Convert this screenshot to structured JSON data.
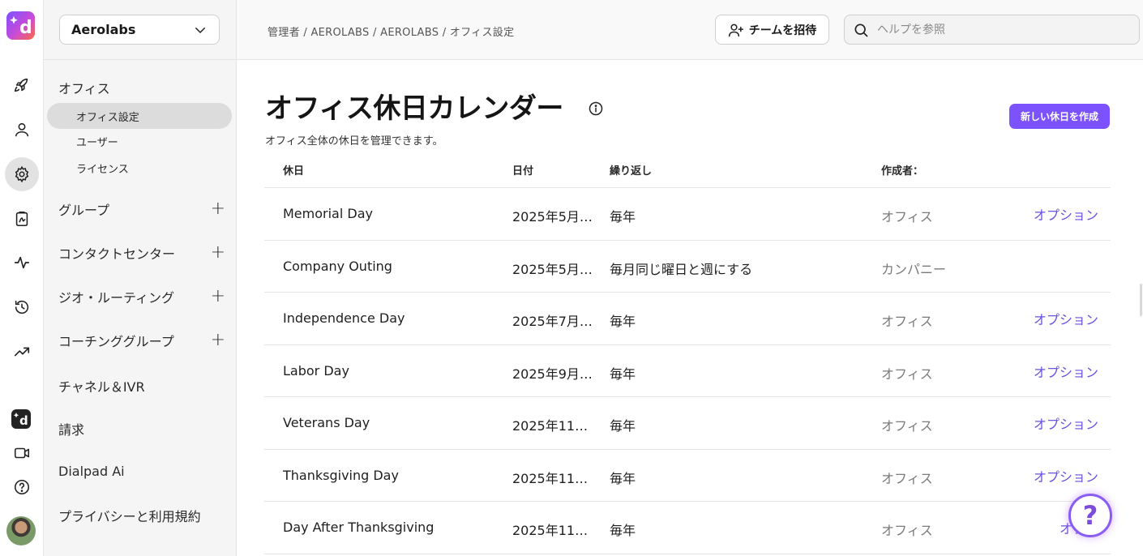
{
  "rail": {
    "items": [
      {
        "icon": "rocket-icon"
      },
      {
        "icon": "user-icon"
      },
      {
        "icon": "gear-icon",
        "active": true
      },
      {
        "icon": "clipboard-icon"
      },
      {
        "icon": "activity-icon"
      },
      {
        "icon": "history-icon"
      },
      {
        "icon": "trending-icon"
      }
    ],
    "bottom": [
      {
        "icon": "dialpad-app-icon"
      },
      {
        "icon": "video-icon"
      },
      {
        "icon": "help-circle-icon"
      },
      {
        "icon": "avatar"
      }
    ]
  },
  "nav": {
    "org": "Aerolabs",
    "section_office": "オフィス",
    "office_items": [
      "オフィス設定",
      "ユーザー",
      "ライセンス"
    ],
    "groups": [
      "グループ",
      "コンタクトセンター",
      "ジオ・ルーティング",
      "コーチンググループ"
    ],
    "links": [
      "チャネル＆IVR",
      "請求",
      "Dialpad Ai",
      "プライバシーと利用規約"
    ]
  },
  "header": {
    "breadcrumb": "管理者 / AEROLABS / AEROLABS / オフィス設定",
    "invite_label": "チームを招待",
    "search_placeholder": "ヘルプを参照"
  },
  "main": {
    "title": "オフィス休日カレンダー",
    "subtitle": "オフィス全体の休日を管理できます。",
    "create_label": "新しい休日を作成",
    "columns": [
      "休日",
      "日付",
      "繰り返し",
      "作成者："
    ],
    "rows": [
      {
        "name": "Memorial Day",
        "date": "2025年5月…",
        "repeat": "毎年",
        "by": "オフィス",
        "option": "オプション"
      },
      {
        "name": "Company Outing",
        "date": "2025年5月…",
        "repeat": "毎月同じ曜日と週にする",
        "by": "カンパニー",
        "option": ""
      },
      {
        "name": "Independence Day",
        "date": "2025年7月…",
        "repeat": "毎年",
        "by": "オフィス",
        "option": "オプション"
      },
      {
        "name": "Labor Day",
        "date": "2025年9月…",
        "repeat": "毎年",
        "by": "オフィス",
        "option": "オプション"
      },
      {
        "name": "Veterans Day",
        "date": "2025年11…",
        "repeat": "毎年",
        "by": "オフィス",
        "option": "オプション"
      },
      {
        "name": "Thanksgiving Day",
        "date": "2025年11…",
        "repeat": "毎年",
        "by": "オフィス",
        "option": "オプション"
      },
      {
        "name": "Day After Thanksgiving",
        "date": "2025年11…",
        "repeat": "毎年",
        "by": "オフィス",
        "option": "オプシ"
      }
    ]
  },
  "help_fab": "?",
  "colors": {
    "accent": "#7c52ff",
    "link": "#6a4fe0",
    "nav_bg": "#f5f5f5"
  }
}
